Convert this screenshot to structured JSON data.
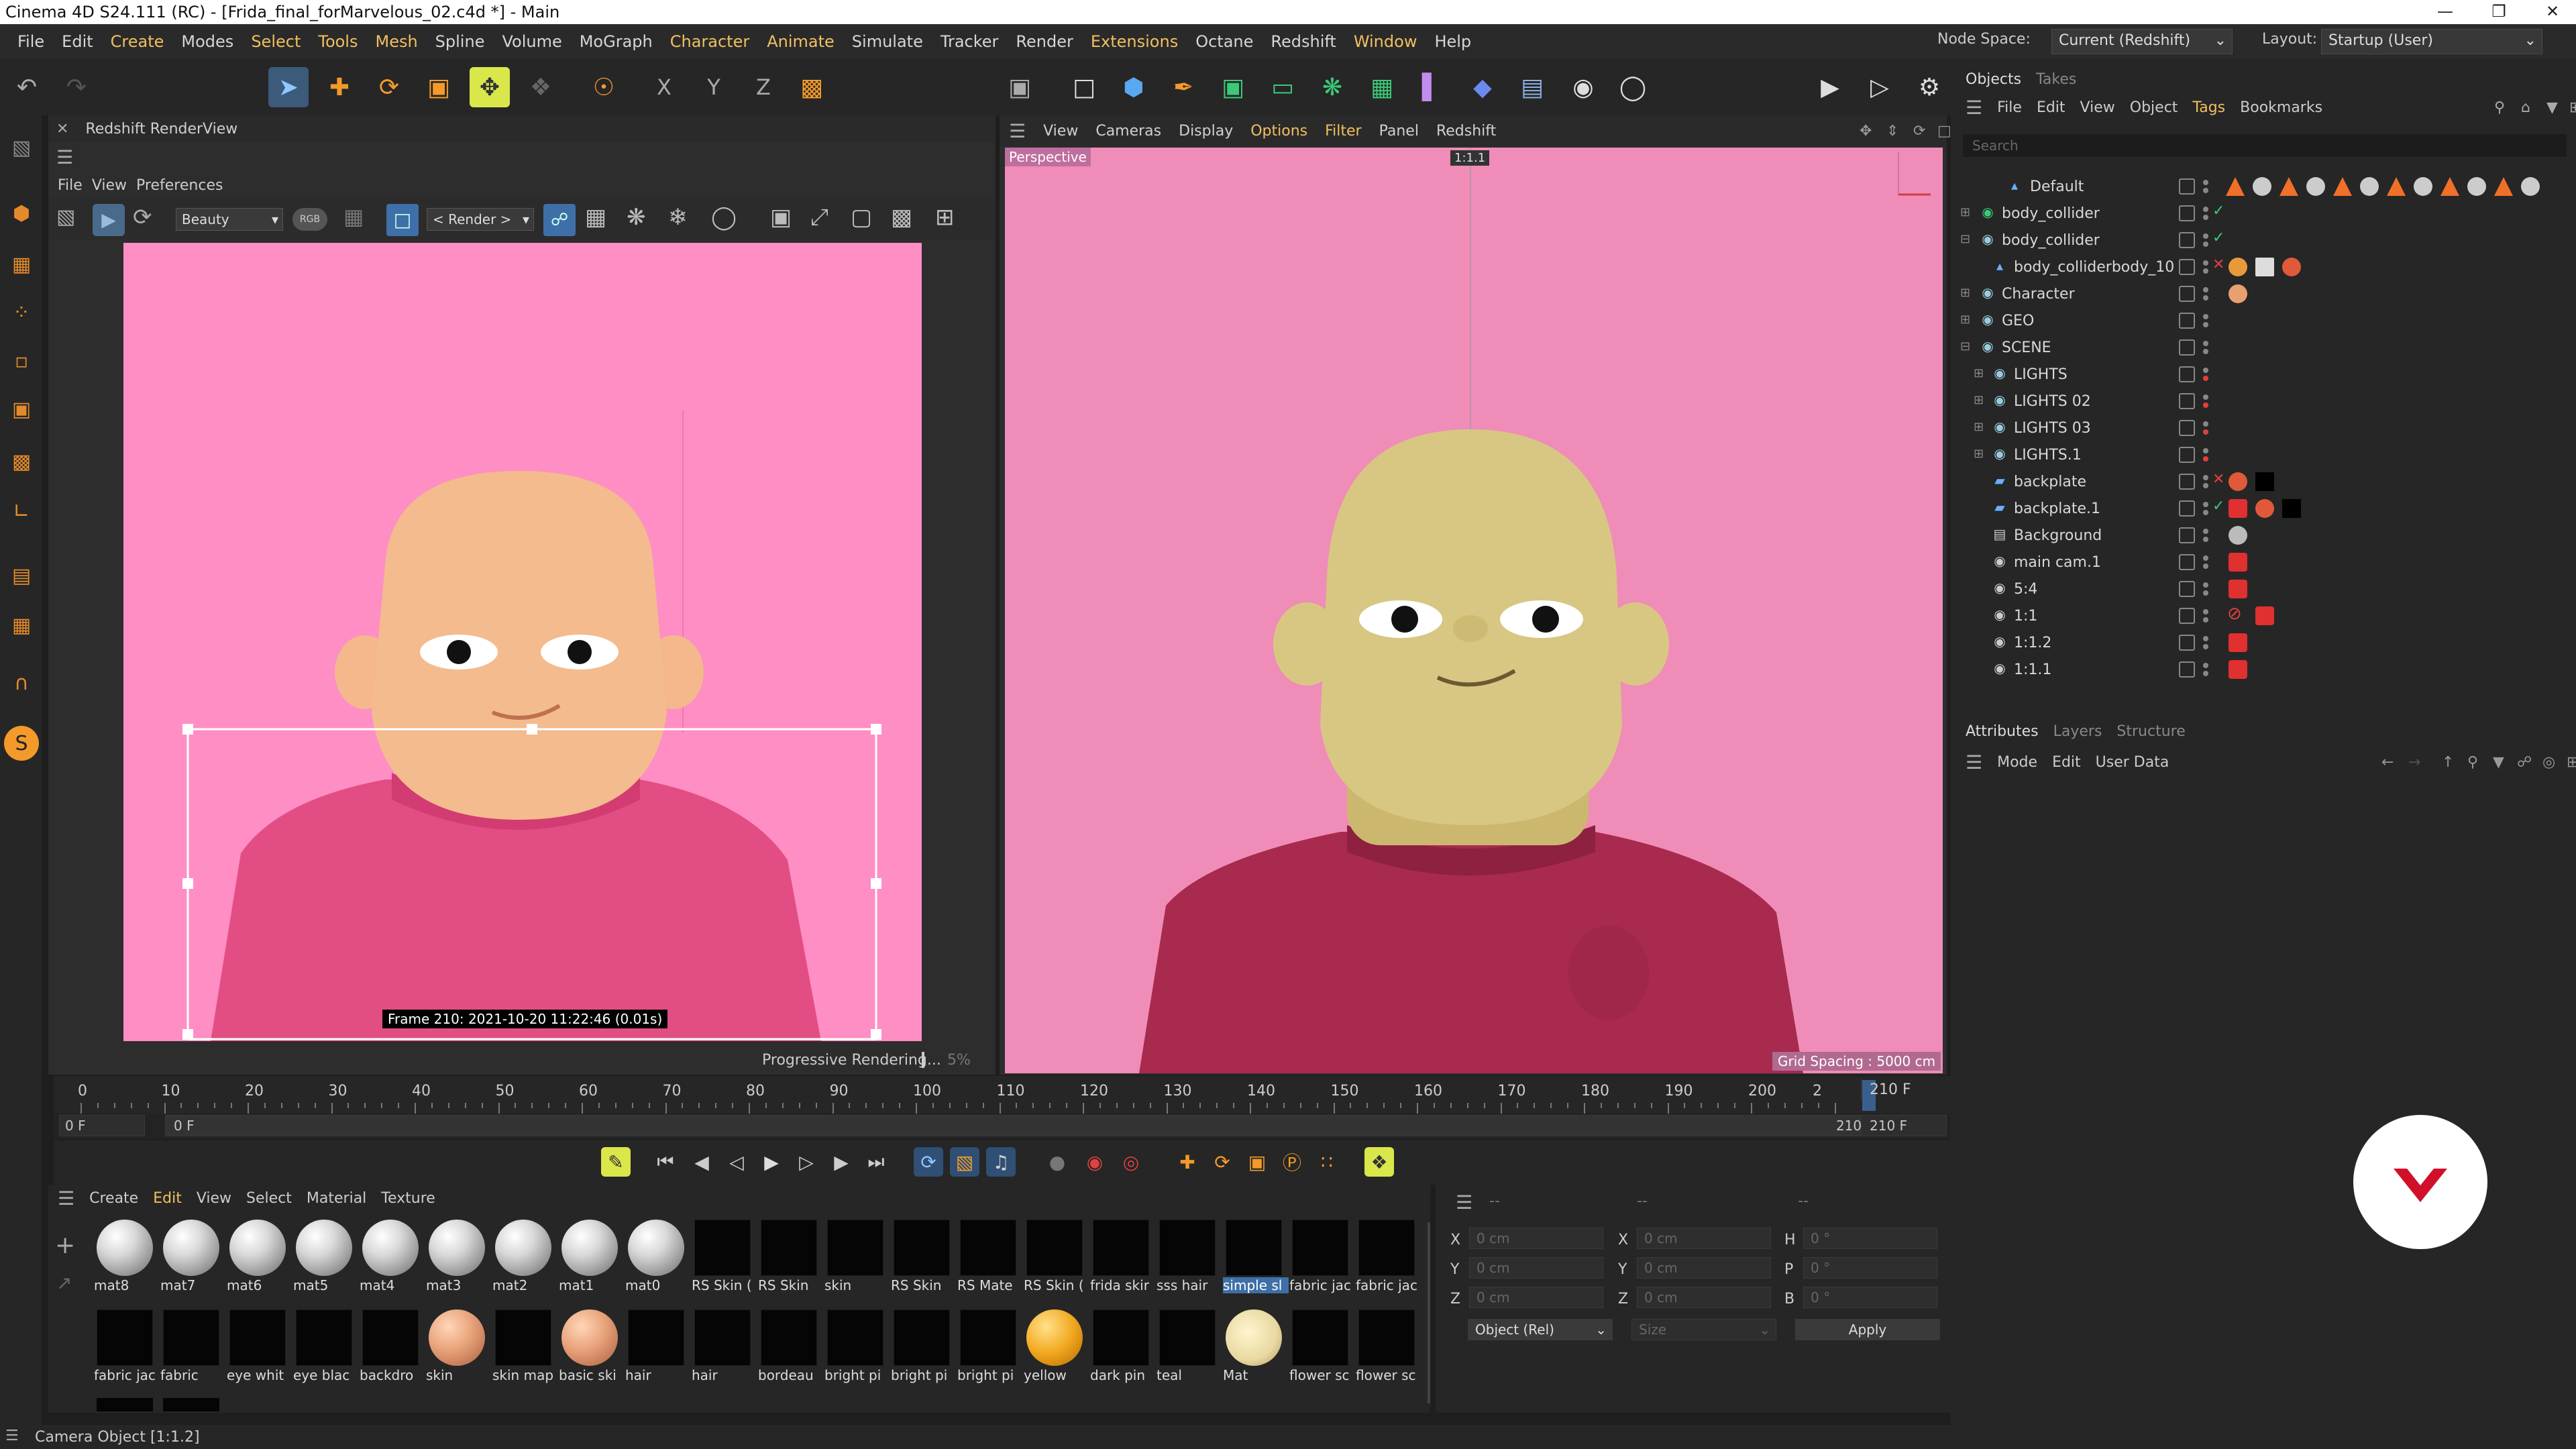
{
  "app": {
    "title": "Cinema 4D S24.111 (RC) - [Frida_final_forMarvelous_02.c4d *] - Main"
  },
  "menu": [
    "File",
    "Edit",
    "Create",
    "Modes",
    "Select",
    "Tools",
    "Mesh",
    "Spline",
    "Volume",
    "MoGraph",
    "Character",
    "Animate",
    "Simulate",
    "Tracker",
    "Render",
    "Extensions",
    "Octane",
    "Redshift",
    "Window",
    "Help"
  ],
  "nodespace": {
    "label": "Node Space:",
    "value": "Current (Redshift)"
  },
  "layout": {
    "label": "Layout:",
    "value": "Startup (User)"
  },
  "axis_tools": {
    "x": "X",
    "y": "Y",
    "z": "Z"
  },
  "renderview": {
    "title": "Redshift RenderView",
    "menu": [
      "File",
      "View",
      "Preferences"
    ],
    "aov": "Beauty",
    "rgb": "RGB",
    "render_btn": "< Render >",
    "frame_info": "Frame  210:  2021-10-20  11:22:46  (0.01s)",
    "status": "Progressive Rendering...",
    "percent": "5%"
  },
  "viewport": {
    "menu": [
      "View",
      "Cameras",
      "Display",
      "Options",
      "Filter",
      "Panel",
      "Redshift"
    ],
    "label": "Perspective",
    "camera_tag": "1:1.1",
    "grid": "Grid Spacing : 5000 cm"
  },
  "objects": {
    "tabs": [
      "Objects",
      "Takes"
    ],
    "menu": [
      "File",
      "Edit",
      "View",
      "Object",
      "Tags",
      "Bookmarks"
    ],
    "search": "Search",
    "items": [
      {
        "name": "Default"
      },
      {
        "name": "body_collider"
      },
      {
        "name": "body_collider"
      },
      {
        "name": "body_colliderbody_10"
      },
      {
        "name": "Character"
      },
      {
        "name": "GEO"
      },
      {
        "name": "SCENE"
      },
      {
        "name": "LIGHTS"
      },
      {
        "name": "LIGHTS 02"
      },
      {
        "name": "LIGHTS 03"
      },
      {
        "name": "LIGHTS.1"
      },
      {
        "name": "backplate"
      },
      {
        "name": "backplate.1"
      },
      {
        "name": "Background"
      },
      {
        "name": "main cam.1"
      },
      {
        "name": "5:4"
      },
      {
        "name": "1:1"
      },
      {
        "name": "1:1.2"
      },
      {
        "name": "1:1.1"
      }
    ]
  },
  "attributes": {
    "tabs": [
      "Attributes",
      "Layers",
      "Structure"
    ],
    "menu": [
      "Mode",
      "Edit",
      "User Data"
    ]
  },
  "timeline": {
    "ticks": [
      "0",
      "10",
      "20",
      "30",
      "40",
      "50",
      "60",
      "70",
      "80",
      "90",
      "100",
      "110",
      "120",
      "130",
      "140",
      "150",
      "160",
      "170",
      "180",
      "190",
      "200",
      "2"
    ],
    "end_field": "210 F",
    "start_field": "0 F",
    "start2": "0 F",
    "end2": "210 F",
    "end3": "210 F",
    "current_frame": 210,
    "max_frame": 210
  },
  "materials": {
    "menu": [
      "Create",
      "Edit",
      "View",
      "Select",
      "Material",
      "Texture"
    ],
    "row1": [
      {
        "label": "mat8",
        "kind": "white"
      },
      {
        "label": "mat7",
        "kind": "white"
      },
      {
        "label": "mat6",
        "kind": "white"
      },
      {
        "label": "mat5",
        "kind": "white"
      },
      {
        "label": "mat4",
        "kind": "white"
      },
      {
        "label": "mat3",
        "kind": "white"
      },
      {
        "label": "mat2",
        "kind": "white"
      },
      {
        "label": "mat1",
        "kind": "white"
      },
      {
        "label": "mat0",
        "kind": "white"
      },
      {
        "label": "RS Skin (",
        "kind": "black"
      },
      {
        "label": "RS Skin",
        "kind": "black"
      },
      {
        "label": "skin",
        "kind": "black"
      },
      {
        "label": "RS Skin",
        "kind": "black"
      },
      {
        "label": "RS Mate",
        "kind": "black"
      },
      {
        "label": "RS Skin (",
        "kind": "black"
      },
      {
        "label": "frida skir",
        "kind": "black"
      },
      {
        "label": "sss hair",
        "kind": "black"
      },
      {
        "label": "simple sl",
        "kind": "black"
      },
      {
        "label": "fabric jac",
        "kind": "black"
      },
      {
        "label": "fabric jac",
        "kind": "black"
      }
    ],
    "row2": [
      {
        "label": "fabric jac",
        "kind": "black"
      },
      {
        "label": "fabric",
        "kind": "black"
      },
      {
        "label": "eye whit",
        "kind": "black"
      },
      {
        "label": "eye blac",
        "kind": "black"
      },
      {
        "label": "backdro",
        "kind": "black"
      },
      {
        "label": "skin",
        "kind": "skin"
      },
      {
        "label": "skin map",
        "kind": "black"
      },
      {
        "label": "basic ski",
        "kind": "skin"
      },
      {
        "label": "hair",
        "kind": "black"
      },
      {
        "label": "hair",
        "kind": "black"
      },
      {
        "label": "bordeau",
        "kind": "black"
      },
      {
        "label": "bright pi",
        "kind": "black"
      },
      {
        "label": "bright pi",
        "kind": "black"
      },
      {
        "label": "bright pi",
        "kind": "black"
      },
      {
        "label": "yellow",
        "kind": "yellow"
      },
      {
        "label": "dark pin",
        "kind": "black"
      },
      {
        "label": "teal",
        "kind": "black"
      },
      {
        "label": "Mat",
        "kind": "face"
      },
      {
        "label": "flower sc",
        "kind": "black"
      },
      {
        "label": "flower sc",
        "kind": "black"
      }
    ]
  },
  "coords": {
    "header": [
      "--",
      "--",
      "--"
    ],
    "labels": [
      "X",
      "Y",
      "Z"
    ],
    "labels2": [
      "X",
      "Y",
      "Z"
    ],
    "labels3": [
      "H",
      "P",
      "B"
    ],
    "val": "0 cm",
    "val_deg": "0 °",
    "mode": "Object (Rel)",
    "size": "Size",
    "apply": "Apply"
  },
  "statusbar": {
    "text": "Camera Object [1:1.2]"
  },
  "colors": {
    "accent": "#f0c060",
    "pink_bg": "#fe8ec4",
    "shirt": "#b82a55",
    "skin_render": "#f1b98a",
    "skin_viewport": "#d8c782"
  }
}
